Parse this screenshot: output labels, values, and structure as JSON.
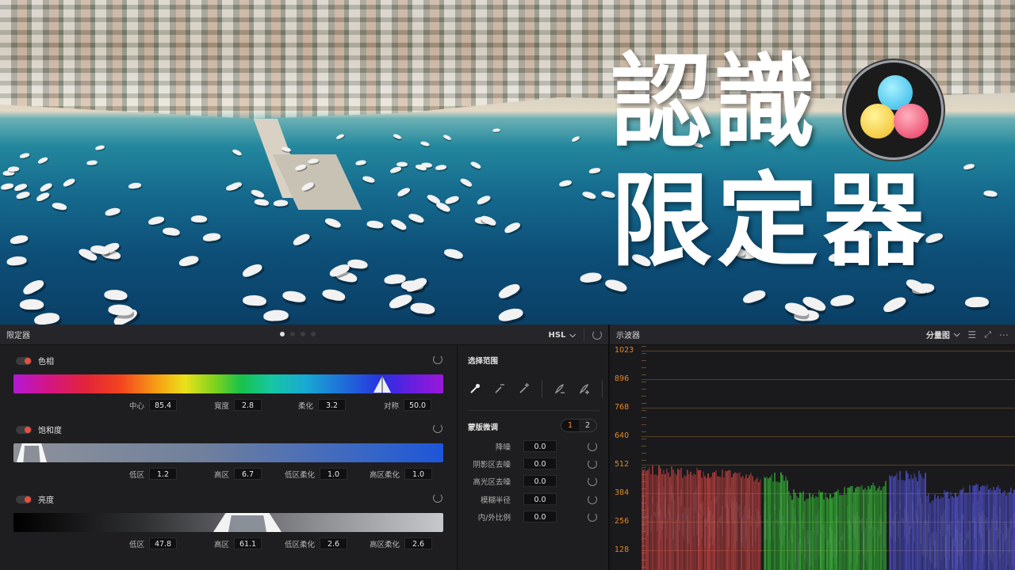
{
  "hero": {
    "title_line1": "認識",
    "title_line2": "限定器",
    "logo_icon": "davinci-resolve-logo-icon"
  },
  "qualifier": {
    "title": "限定器",
    "mode": "HSL",
    "sections": {
      "hue": {
        "label": "色相",
        "params": [
          {
            "label": "中心",
            "value": "85.4"
          },
          {
            "label": "寬度",
            "value": "2.8"
          },
          {
            "label": "柔化",
            "value": "3.2"
          },
          {
            "label": "对称",
            "value": "50.0"
          }
        ]
      },
      "saturation": {
        "label": "饱和度",
        "params": [
          {
            "label": "低区",
            "value": "1.2"
          },
          {
            "label": "高区",
            "value": "6.7"
          },
          {
            "label": "低区柔化",
            "value": "1.0"
          },
          {
            "label": "高区柔化",
            "value": "1.0"
          }
        ]
      },
      "luminance": {
        "label": "亮度",
        "params": [
          {
            "label": "低区",
            "value": "47.8"
          },
          {
            "label": "高区",
            "value": "61.1"
          },
          {
            "label": "低区柔化",
            "value": "2.6"
          },
          {
            "label": "高区柔化",
            "value": "2.6"
          }
        ]
      }
    },
    "selection": {
      "title": "选择范围",
      "tools": [
        "eyedropper-icon",
        "eyedropper-minus-icon",
        "eyedropper-plus-icon",
        "feather-minus-icon",
        "feather-plus-icon",
        "invert-icon"
      ]
    },
    "matte": {
      "title": "蒙版微调",
      "pages": [
        "1",
        "2"
      ],
      "rows": [
        {
          "label": "降噪",
          "value": "0.0"
        },
        {
          "label": "阴影区去噪",
          "value": "0.0"
        },
        {
          "label": "高光区去噪",
          "value": "0.0"
        },
        {
          "label": "模糊半径",
          "value": "0.0"
        },
        {
          "label": "内/外比例",
          "value": "0.0"
        }
      ]
    }
  },
  "scope": {
    "title": "示波器",
    "mode": "分量图",
    "y_labels": [
      "1023",
      "896",
      "768",
      "640",
      "512",
      "384",
      "256",
      "128"
    ],
    "colors": {
      "red": "#e04848",
      "green": "#3ad23a",
      "blue": "#5a5af0",
      "axis": "#e08a2a"
    }
  }
}
